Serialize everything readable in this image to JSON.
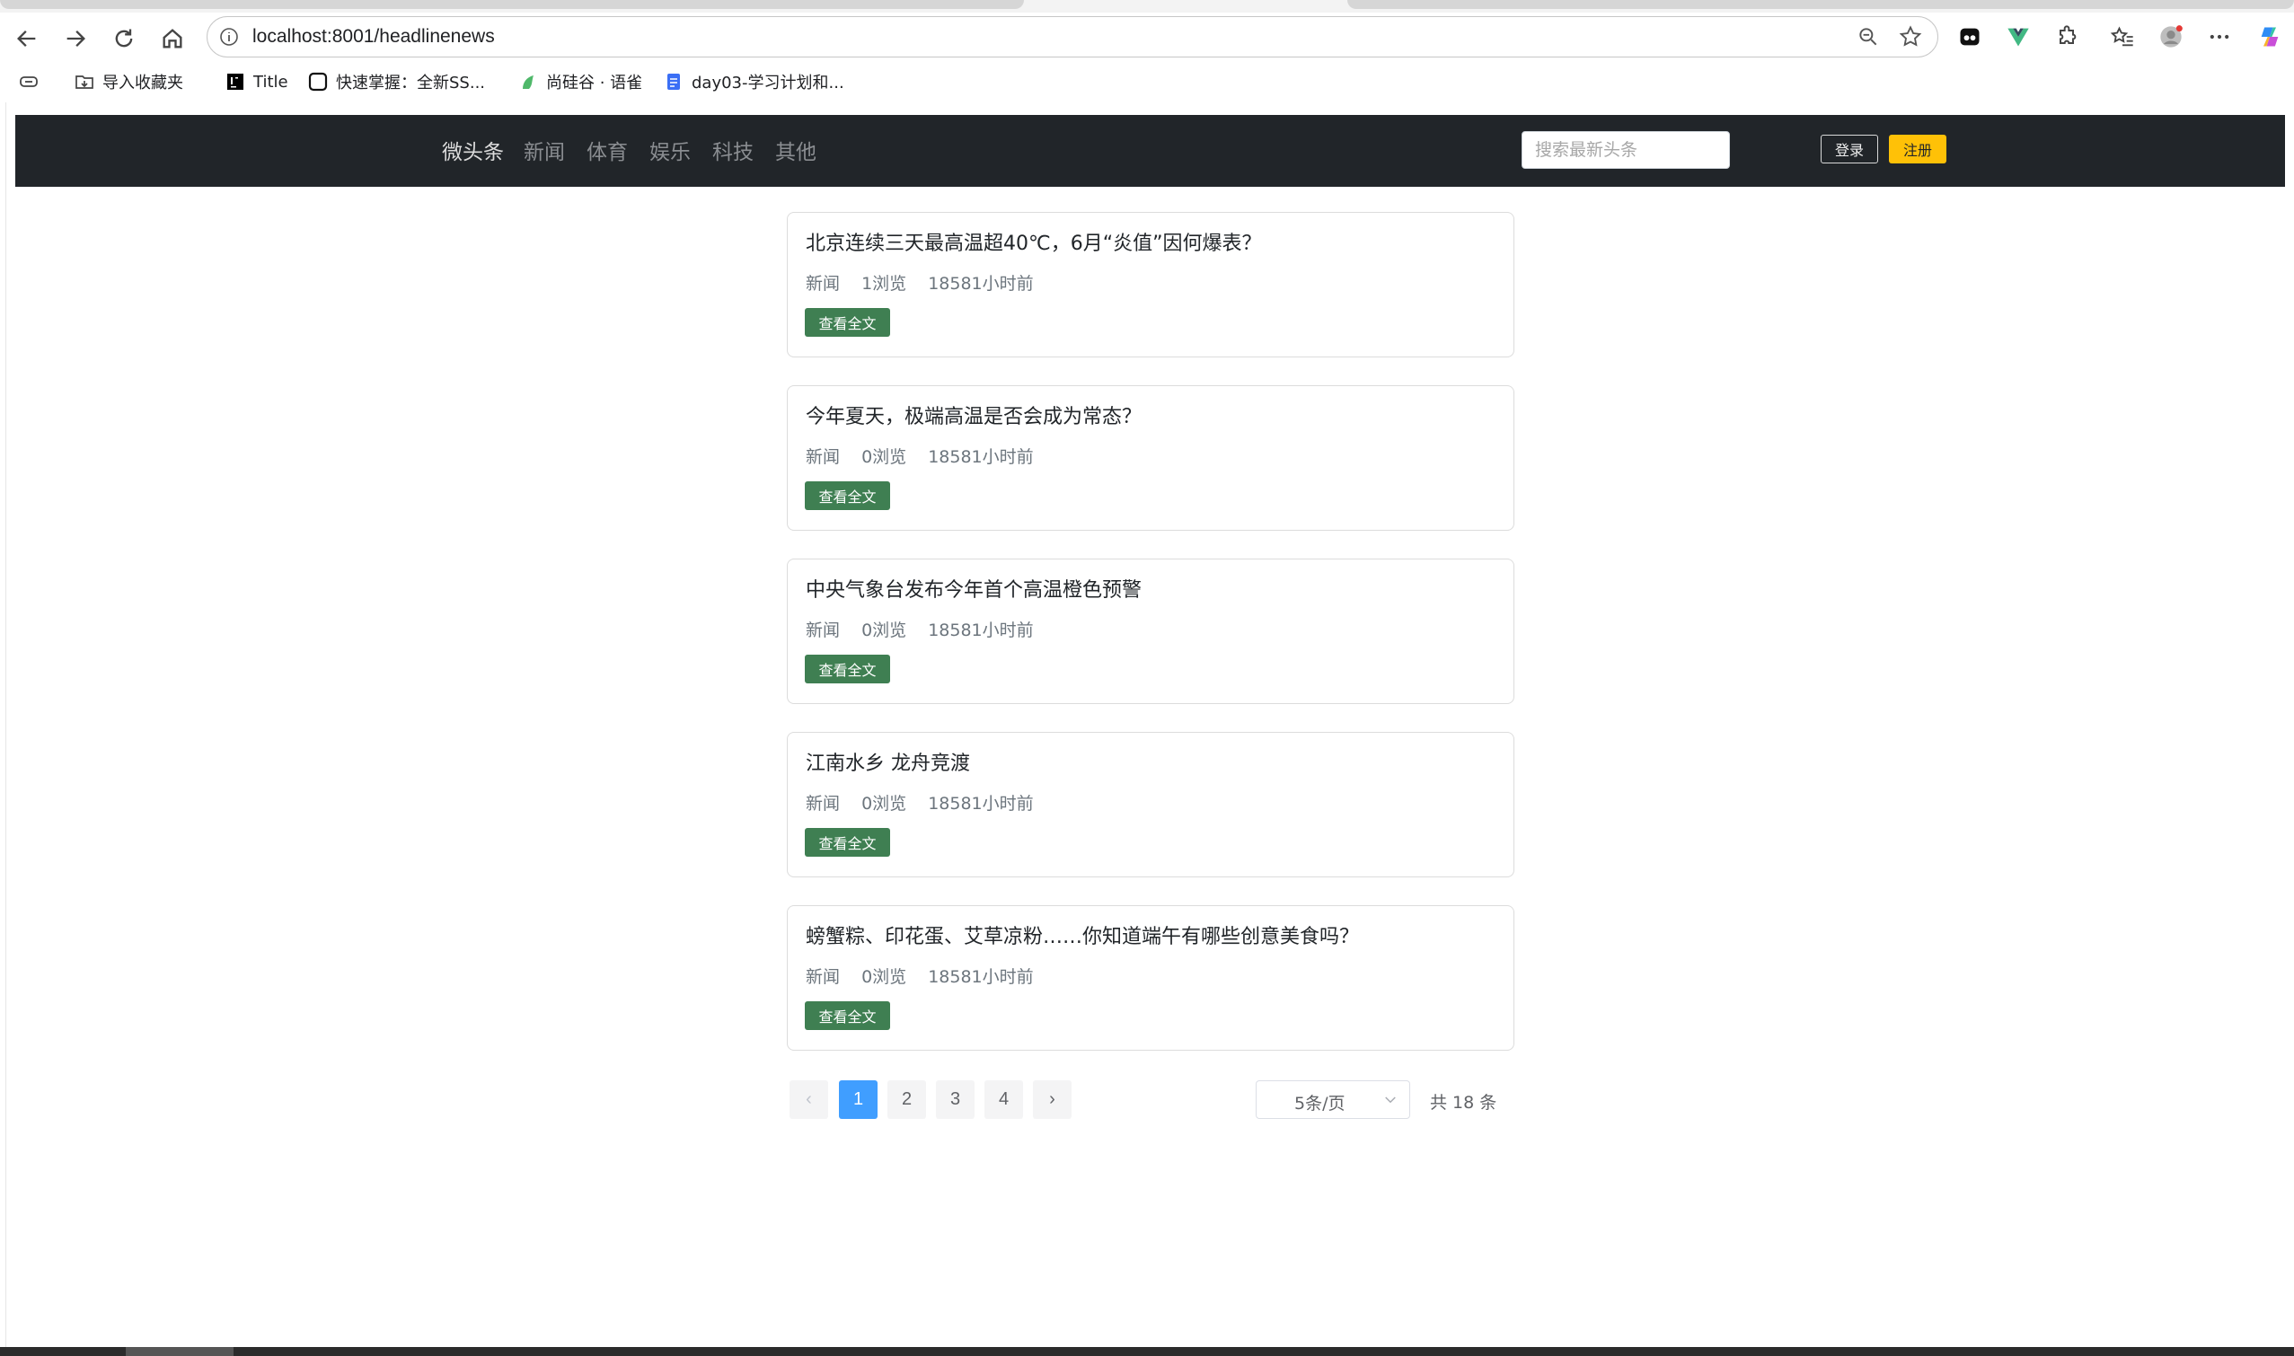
{
  "browser": {
    "url": "localhost:8001/headlinenews",
    "bookmarks": [
      {
        "label": "导入收藏夹",
        "icon": "import-bookmarks-icon"
      },
      {
        "label": "Title",
        "icon": "jetbrains-icon"
      },
      {
        "label": "快速掌握：全新SS...",
        "icon": "terminal-icon"
      },
      {
        "label": "尚硅谷 · 语雀",
        "icon": "yuque-icon"
      },
      {
        "label": "day03-学习计划和...",
        "icon": "document-icon"
      }
    ]
  },
  "navbar": {
    "brand": "微头条",
    "links": [
      "新闻",
      "体育",
      "娱乐",
      "科技",
      "其他"
    ],
    "search_placeholder": "搜索最新头条",
    "login_label": "登录",
    "register_label": "注册"
  },
  "news": [
    {
      "title": "北京连续三天最高温超40℃，6月“炎值”因何爆表？",
      "category": "新闻",
      "views": "1浏览",
      "time": "18581小时前",
      "button": "查看全文"
    },
    {
      "title": "今年夏天，极端高温是否会成为常态？",
      "category": "新闻",
      "views": "0浏览",
      "time": "18581小时前",
      "button": "查看全文"
    },
    {
      "title": "中央气象台发布今年首个高温橙色预警",
      "category": "新闻",
      "views": "0浏览",
      "time": "18581小时前",
      "button": "查看全文"
    },
    {
      "title": "江南水乡 龙舟竞渡",
      "category": "新闻",
      "views": "0浏览",
      "time": "18581小时前",
      "button": "查看全文"
    },
    {
      "title": "螃蟹粽、印花蛋、艾草凉粉……你知道端午有哪些创意美食吗？",
      "category": "新闻",
      "views": "0浏览",
      "time": "18581小时前",
      "button": "查看全文"
    }
  ],
  "pagination": {
    "prev": "‹",
    "next": "›",
    "pages": [
      "1",
      "2",
      "3",
      "4"
    ],
    "current": "1",
    "page_size": "5条/页",
    "total": "共 18 条"
  },
  "colors": {
    "navbar_bg": "#212529",
    "register_btn": "#ffc107",
    "read_btn": "#3f7f52",
    "active_page": "#409eff"
  }
}
